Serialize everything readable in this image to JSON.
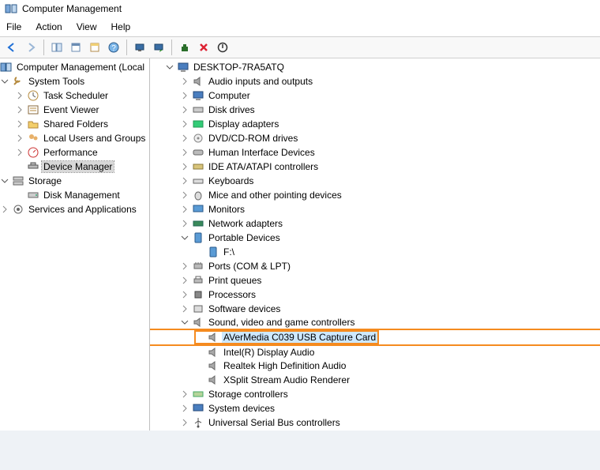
{
  "title": "Computer Management",
  "menu": {
    "file": "File",
    "action": "Action",
    "view": "View",
    "help": "Help"
  },
  "left_tree": {
    "root": "Computer Management (Local",
    "system_tools": "System Tools",
    "task_scheduler": "Task Scheduler",
    "event_viewer": "Event Viewer",
    "shared_folders": "Shared Folders",
    "local_users": "Local Users and Groups",
    "performance": "Performance",
    "device_manager": "Device Manager",
    "storage": "Storage",
    "disk_management": "Disk Management",
    "services_apps": "Services and Applications"
  },
  "right_tree": {
    "root": "DESKTOP-7RA5ATQ",
    "audio_io": "Audio inputs and outputs",
    "computer": "Computer",
    "disk_drives": "Disk drives",
    "display_adapters": "Display adapters",
    "dvd": "DVD/CD-ROM drives",
    "hid": "Human Interface Devices",
    "ide": "IDE ATA/ATAPI controllers",
    "keyboards": "Keyboards",
    "mice": "Mice and other pointing devices",
    "monitors": "Monitors",
    "network": "Network adapters",
    "portable": "Portable Devices",
    "f_drive": "F:\\",
    "ports": "Ports (COM & LPT)",
    "print_queues": "Print queues",
    "processors": "Processors",
    "software_devices": "Software devices",
    "svc": "Sound, video and game controllers",
    "avermedia": "AVerMedia C039 USB Capture Card",
    "intel_audio": "Intel(R) Display Audio",
    "realtek": "Realtek High Definition Audio",
    "xsplit": "XSplit  Stream  Audio  Renderer",
    "storage_ctrl": "Storage controllers",
    "system_devices": "System devices",
    "usb_ctrl": "Universal Serial Bus controllers"
  }
}
